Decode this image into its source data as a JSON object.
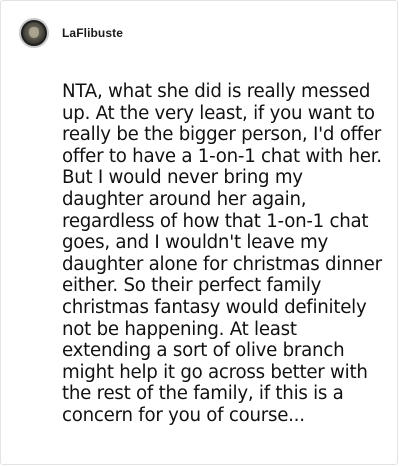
{
  "comment": {
    "author": "LaFlibuste",
    "avatar_icon": "user-avatar-icon",
    "body": "NTA, what she did is really messed up. At the very least, if you want to really be the bigger person, I'd offer offer to have a 1-on-1 chat with her. But I would never bring my daughter around her again, regardless of how that 1-on-1 chat goes, and I wouldn't leave my daughter alone for christmas dinner either. So their perfect family christmas fantasy would definitely not be happening. At least extending a sort of olive branch might help it go across better with the rest of the family, if this is a concern for you of course..."
  },
  "colors": {
    "background": "#ffffff",
    "border": "#e3e3e3",
    "text": "#111111"
  }
}
